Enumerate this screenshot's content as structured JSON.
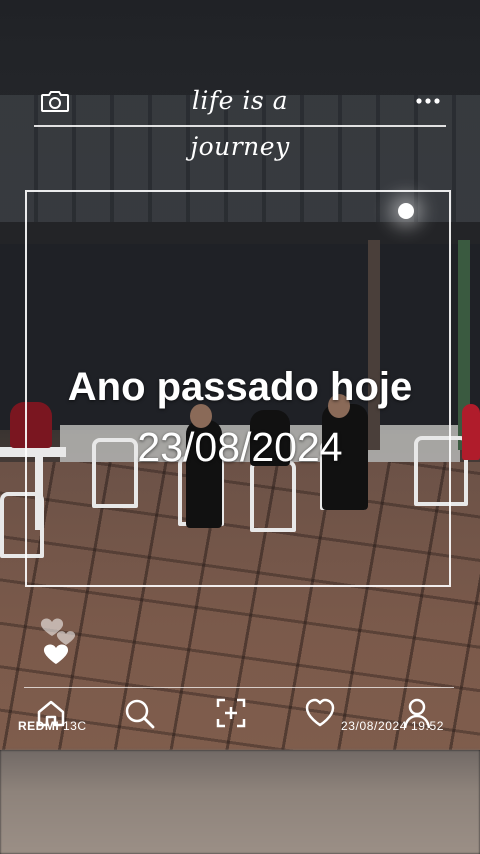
{
  "header": {
    "title": "life is a journey",
    "camera_icon": "camera-icon",
    "more_icon": "more-dots-icon"
  },
  "overlay": {
    "line1": "Ano passado hoje",
    "line2": "23/08/2024"
  },
  "decor": {
    "hearts_icon": "hearts-icon"
  },
  "bottom_nav": {
    "icons": [
      "home-icon",
      "search-icon",
      "add-icon",
      "heart-icon",
      "person-icon"
    ]
  },
  "watermark": {
    "brand": "REDMI",
    "model": " 13C",
    "stamp": "23/08/2024  19:52"
  },
  "colors": {
    "overlay_text": "#ffffff",
    "frame": "#ffffff"
  }
}
